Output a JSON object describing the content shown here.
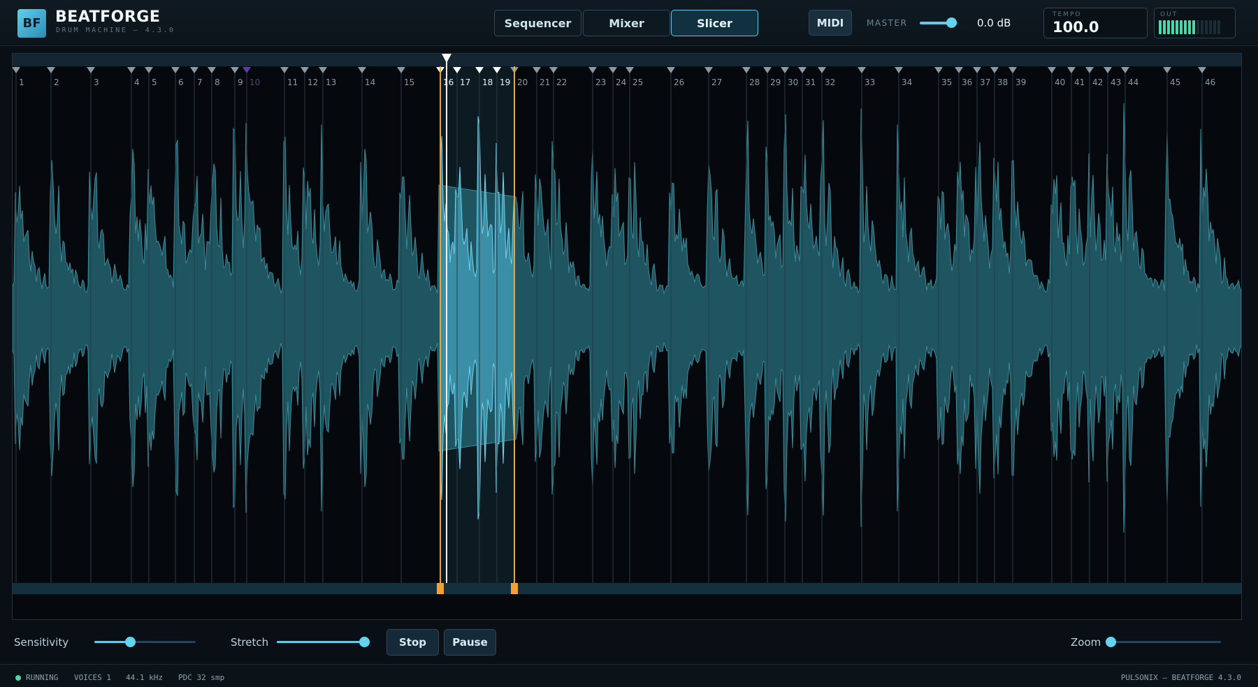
{
  "app": {
    "logo_text": "BF",
    "name": "BEATFORGE",
    "subtitle": "DRUM MACHINE  –  4.3.0"
  },
  "mode_tabs": [
    {
      "label": "Sequencer",
      "active": false
    },
    {
      "label": "Mixer",
      "active": false
    },
    {
      "label": "Slicer",
      "active": true
    }
  ],
  "midi_label": "MIDI",
  "master": {
    "label": "MASTER",
    "value": "0.0 dB",
    "level": 0.82
  },
  "tempo": {
    "label": "TEMPO",
    "value": "100.0"
  },
  "output": {
    "label": "OUT",
    "active_segments": 9,
    "total_segments": 15
  },
  "slicer": {
    "slices": [
      "1",
      "2",
      "3",
      "4",
      "5",
      "6",
      "7",
      "8",
      "9",
      "10",
      "11",
      "12",
      "13",
      "14",
      "15",
      "16",
      "17",
      "18",
      "19",
      "20",
      "21",
      "22",
      "23",
      "24",
      "25",
      "26",
      "27",
      "28",
      "29",
      "30",
      "31",
      "32",
      "33",
      "34",
      "35",
      "36",
      "37",
      "38",
      "39",
      "40",
      "41",
      "42",
      "43",
      "44",
      "45",
      "46"
    ],
    "selected_slices": [
      "16",
      "17",
      "18",
      "19"
    ],
    "playhead_slice": "16",
    "waveform_color": "#3c8b99",
    "selection_color": "#6fd3ef",
    "marker_color": "#f0a23a"
  },
  "controls": {
    "sensitivity": {
      "label": "Sensitivity",
      "value": 0.35
    },
    "stretch": {
      "label": "Stretch",
      "value": 1.0
    },
    "stop_label": "Stop",
    "pause_label": "Pause",
    "zoom": {
      "label": "Zoom",
      "value": 0.0
    }
  },
  "status": {
    "state": "RUNNING",
    "voices": "VOICES 1",
    "sample_rate": "44.1 kHz",
    "pdc": "PDC 32 smp",
    "brand": "PULSONIX  –  BEATFORGE 4.3.0"
  },
  "colors": {
    "accent": "#5fcde8",
    "status_ok": "#4fd6a8",
    "marker": "#f0a23a"
  }
}
